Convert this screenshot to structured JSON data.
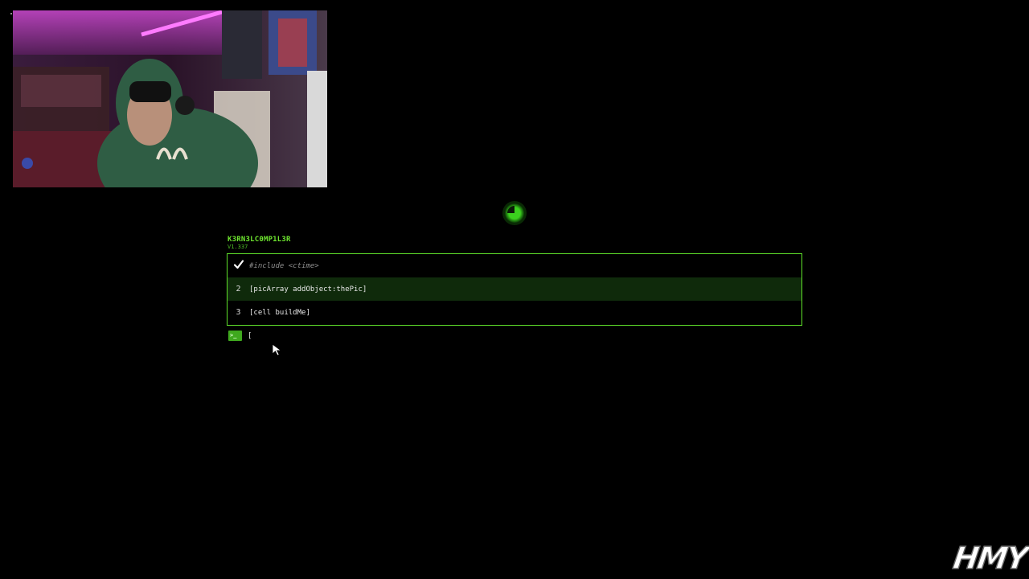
{
  "app": {
    "title": "K3RN3LC0MP1L3R",
    "version": "V1.337"
  },
  "editor": {
    "lines": [
      {
        "gutter": "check-icon",
        "text": "#include <ctime>",
        "status": "done"
      },
      {
        "gutter": "2",
        "text": "[picArray addObject:thePic]",
        "status": "active"
      },
      {
        "gutter": "3",
        "text": "[cell buildMe]",
        "status": "pending"
      }
    ]
  },
  "console": {
    "prompt_icon": "terminal-icon",
    "prompt_glyph": ">_",
    "input_value": "["
  },
  "spinner": {
    "icon": "loading-pie-icon",
    "progress": 0.25
  },
  "watermark": {
    "text": "HMY"
  },
  "colors": {
    "accent": "#5fe12a",
    "active_row": "#0f2a0b",
    "background": "#000000"
  }
}
